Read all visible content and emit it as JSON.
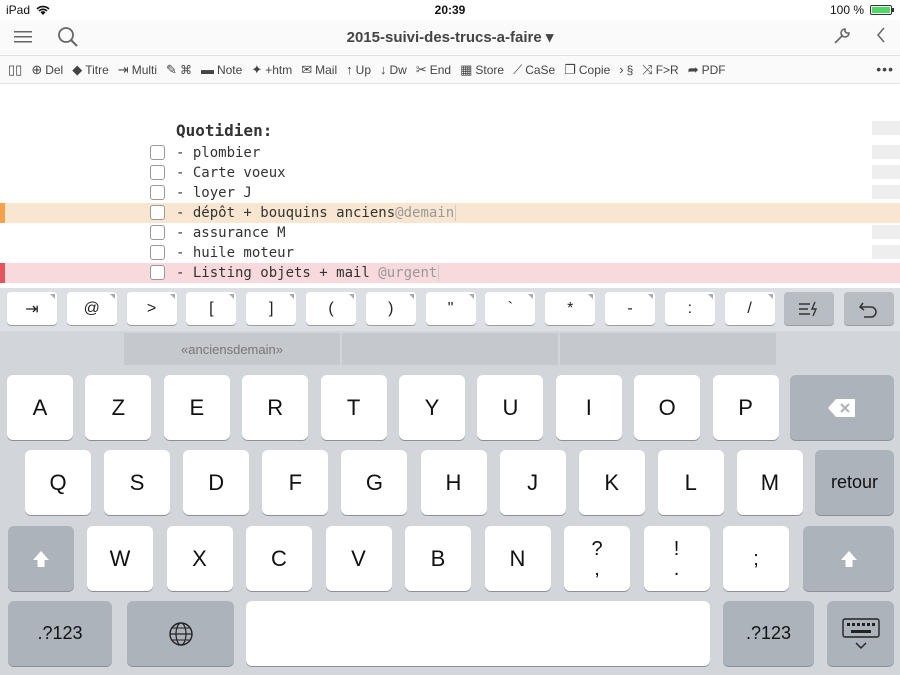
{
  "status": {
    "device": "iPad",
    "time": "20:39",
    "battery": "100 %",
    "battery_level": 1.0
  },
  "titlebar": {
    "title": "2015-suivi-des-trucs-a-faire ▾"
  },
  "toolbar": {
    "items": [
      {
        "icon": "book-icon",
        "label": ""
      },
      {
        "icon": "delete-icon",
        "label": "Del"
      },
      {
        "icon": "tag-icon",
        "label": "Titre"
      },
      {
        "icon": "multi-icon",
        "label": "Multi"
      },
      {
        "icon": "edit-icon",
        "label": "⌘"
      },
      {
        "icon": "note-icon",
        "label": "Note"
      },
      {
        "icon": "pin-icon",
        "label": "+htm"
      },
      {
        "icon": "mail-icon",
        "label": "Mail"
      },
      {
        "icon": "arrow-up-icon",
        "label": "Up"
      },
      {
        "icon": "arrow-down-icon",
        "label": "Dw"
      },
      {
        "icon": "scissors-icon",
        "label": "End"
      },
      {
        "icon": "store-icon",
        "label": "Store"
      },
      {
        "icon": "chart-icon",
        "label": "CaSe"
      },
      {
        "icon": "copy-icon",
        "label": "Copie"
      },
      {
        "icon": "chevron-right-icon",
        "label": "§"
      },
      {
        "icon": "shuffle-icon",
        "label": "F>R"
      },
      {
        "icon": "share-icon",
        "label": "PDF"
      }
    ],
    "more": "•••"
  },
  "editor": {
    "heading": "Quotidien:",
    "rows": [
      {
        "text": "- plombier",
        "tag": "",
        "highlight": "none"
      },
      {
        "text": "- Carte voeux",
        "tag": "",
        "highlight": "none"
      },
      {
        "text": "- loyer J",
        "tag": "",
        "highlight": "none"
      },
      {
        "text": "- dépôt + bouquins anciens",
        "tag": "@demain",
        "highlight": "orange"
      },
      {
        "text": "- assurance M",
        "tag": "",
        "highlight": "none"
      },
      {
        "text": "- huile moteur",
        "tag": "",
        "highlight": "none"
      },
      {
        "text": "- Listing objets + mail ",
        "tag": "@urgent",
        "highlight": "pink"
      }
    ]
  },
  "accessory": {
    "keys": [
      "⇥",
      "@",
      ">",
      "[",
      "]",
      "(",
      ")",
      "\"",
      "`",
      "*",
      "-",
      ":",
      "/"
    ],
    "format_icon": "format-icon",
    "undo_icon": "undo-icon"
  },
  "suggestions": [
    "«anciensdemain»",
    "",
    ""
  ],
  "keyboard": {
    "row1": [
      "A",
      "Z",
      "E",
      "R",
      "T",
      "Y",
      "U",
      "I",
      "O",
      "P"
    ],
    "row2": [
      "Q",
      "S",
      "D",
      "F",
      "G",
      "H",
      "J",
      "K",
      "L",
      "M"
    ],
    "row3": [
      "W",
      "X",
      "C",
      "V",
      "B",
      "N"
    ],
    "row3_punct": [
      [
        "?",
        ","
      ],
      [
        "!",
        "."
      ],
      [
        ";",
        ""
      ]
    ],
    "return_label": "retour",
    "num_label": ".?123",
    "colors": {
      "orange_marker": "#f5a04a",
      "pink_marker": "#e55560"
    }
  }
}
